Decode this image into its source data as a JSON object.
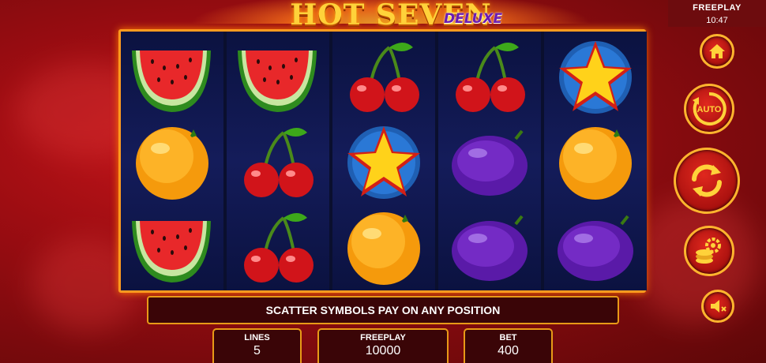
{
  "game": {
    "title_main": "HOT SEVEN",
    "title_sub": "DELUXE"
  },
  "status": {
    "mode": "FREEPLAY",
    "time": "10:47"
  },
  "reels": [
    [
      "watermelon",
      "orange",
      "watermelon"
    ],
    [
      "watermelon",
      "cherry",
      "cherry"
    ],
    [
      "cherry",
      "star-scatter",
      "orange"
    ],
    [
      "cherry",
      "plum",
      "plum"
    ],
    [
      "star-scatter",
      "orange",
      "plum"
    ]
  ],
  "message": "SCATTER SYMBOLS PAY ON ANY POSITION",
  "panels": {
    "lines_label": "LINES",
    "lines_value": "5",
    "freeplay_label": "FREEPLAY",
    "freeplay_value": "10000",
    "bet_label": "BET",
    "bet_value": "400"
  },
  "controls": {
    "auto_label": "AUTO",
    "icons": [
      "home-icon",
      "autoplay-icon",
      "spin-icon",
      "coin-settings-icon",
      "sound-mute-icon"
    ]
  },
  "colors": {
    "frame": "#ff9a1f",
    "background": "#9e0d12",
    "title": "#ffd23a",
    "panel_border": "#e89a17"
  }
}
